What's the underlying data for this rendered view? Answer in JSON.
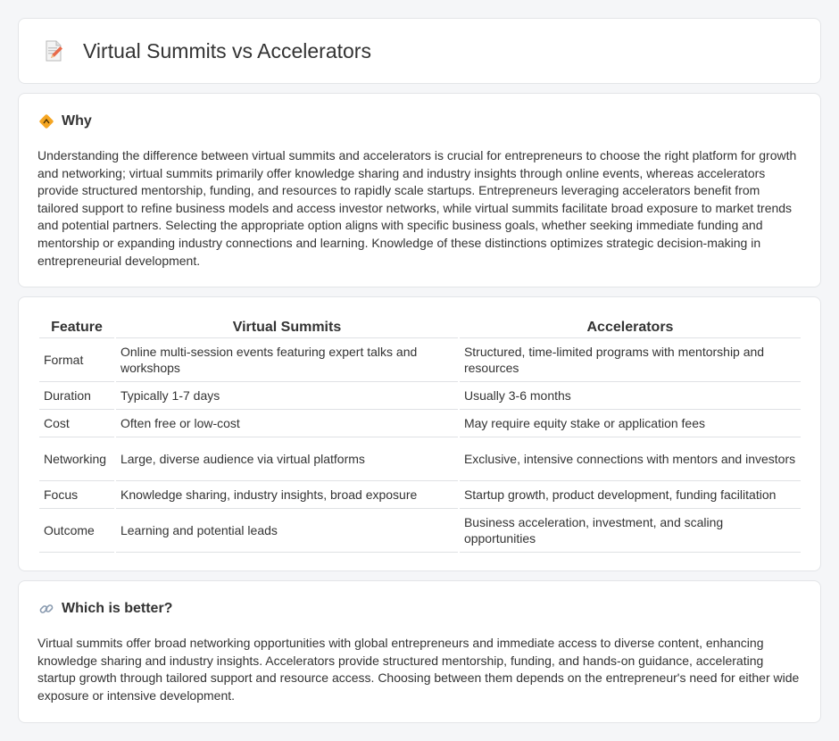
{
  "header": {
    "title": "Virtual Summits vs Accelerators",
    "icon": "document-edit-icon"
  },
  "why": {
    "title": "Why",
    "icon": "diamond-sign-icon",
    "body": "Understanding the difference between virtual summits and accelerators is crucial for entrepreneurs to choose the right platform for growth and networking; virtual summits primarily offer knowledge sharing and industry insights through online events, whereas accelerators provide structured mentorship, funding, and resources to rapidly scale startups. Entrepreneurs leveraging accelerators benefit from tailored support to refine business models and access investor networks, while virtual summits facilitate broad exposure to market trends and potential partners. Selecting the appropriate option aligns with specific business goals, whether seeking immediate funding and mentorship or expanding industry connections and learning. Knowledge of these distinctions optimizes strategic decision-making in entrepreneurial development."
  },
  "table": {
    "headers": [
      "Feature",
      "Virtual Summits",
      "Accelerators"
    ],
    "rows": [
      [
        "Format",
        "Online multi-session events featuring expert talks and workshops",
        "Structured, time-limited programs with mentorship and resources"
      ],
      [
        "Duration",
        "Typically 1-7 days",
        "Usually 3-6 months"
      ],
      [
        "Cost",
        "Often free or low-cost",
        "May require equity stake or application fees"
      ],
      [
        "Networking",
        "Large, diverse audience via virtual platforms",
        "Exclusive, intensive connections with mentors and investors"
      ],
      [
        "Focus",
        "Knowledge sharing, industry insights, broad exposure",
        "Startup growth, product development, funding facilitation"
      ],
      [
        "Outcome",
        "Learning and potential leads",
        "Business acceleration, investment, and scaling opportunities"
      ]
    ]
  },
  "better": {
    "title": "Which is better?",
    "icon": "link-icon",
    "body": "Virtual summits offer broad networking opportunities with global entrepreneurs and immediate access to diverse content, enhancing knowledge sharing and industry insights. Accelerators provide structured mentorship, funding, and hands-on guidance, accelerating startup growth through tailored support and resource access. Choosing between them depends on the entrepreneur's need for either wide exposure or intensive development."
  }
}
